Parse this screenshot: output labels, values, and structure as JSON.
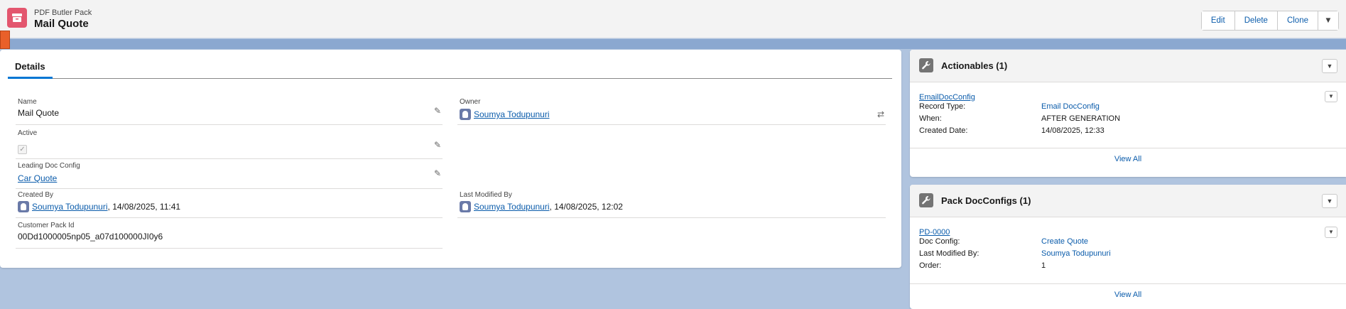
{
  "header": {
    "object_label": "PDF Butler Pack",
    "record_title": "Mail Quote",
    "actions": [
      "Edit",
      "Delete",
      "Clone"
    ],
    "more_icon": "chevron-down-icon",
    "accent_color": "#e3566e"
  },
  "details": {
    "tab_label": "Details",
    "fields": {
      "name": {
        "label": "Name",
        "value": "Mail Quote"
      },
      "owner": {
        "label": "Owner",
        "value": "Soumya Todupunuri"
      },
      "active": {
        "label": "Active",
        "checked": true
      },
      "leading_doc_config": {
        "label": "Leading Doc Config",
        "value": "Car Quote"
      },
      "created_by": {
        "label": "Created By",
        "user": "Soumya Todupunuri",
        "date": ", 14/08/2025, 11:41"
      },
      "last_modified_by": {
        "label": "Last Modified By",
        "user": "Soumya Todupunuri",
        "date": ", 14/08/2025, 12:02"
      },
      "customer_pack_id": {
        "label": "Customer Pack Id",
        "value": "00Dd1000005np05_a07d100000JI0y6"
      }
    }
  },
  "actionables": {
    "title": "Actionables (1)",
    "record": {
      "name": "EmailDocConfig",
      "rows": [
        {
          "key": "Record Type:",
          "value": "Email DocConfig",
          "is_link": true
        },
        {
          "key": "When:",
          "value": "AFTER GENERATION",
          "is_link": false
        },
        {
          "key": "Created Date:",
          "value": "14/08/2025, 12:33",
          "is_link": false
        }
      ]
    },
    "view_all": "View All"
  },
  "pack_docconfigs": {
    "title": "Pack DocConfigs (1)",
    "record": {
      "name": "PD-0000",
      "rows": [
        {
          "key": "Doc Config:",
          "value": "Create Quote",
          "is_link": true
        },
        {
          "key": "Last Modified By:",
          "value": "Soumya Todupunuri",
          "is_link": true
        },
        {
          "key": "Order:",
          "value": "1",
          "is_link": false
        }
      ]
    },
    "view_all": "View All"
  }
}
